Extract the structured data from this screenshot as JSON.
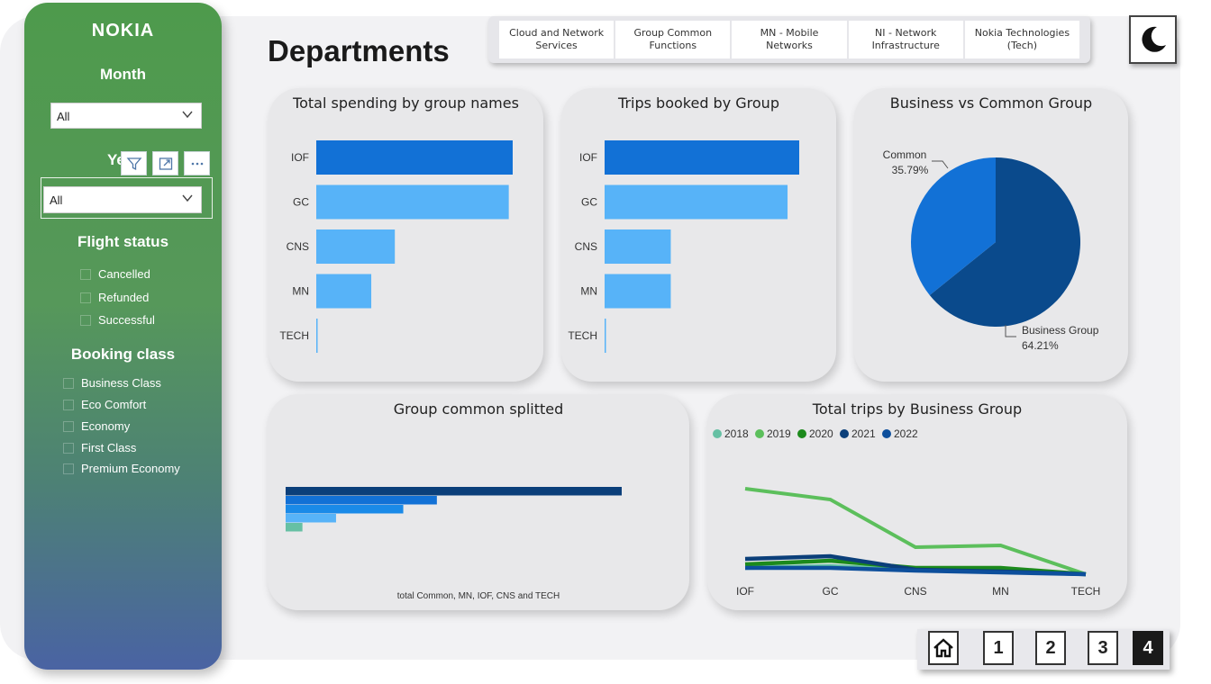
{
  "sidebar": {
    "logo": "NOKIA",
    "month_label": "Month",
    "month_value": "All",
    "year_label": "Ye",
    "year_value": "All",
    "flight_status_label": "Flight status",
    "flight_status": [
      "Cancelled",
      "Refunded",
      "Successful"
    ],
    "booking_class_label": "Booking class",
    "booking_class": [
      "Business Class",
      "Eco Comfort",
      "Economy",
      "First Class",
      "Premium Economy"
    ]
  },
  "header": {
    "title": "Departments",
    "tabs": [
      "Cloud and Network Services",
      "Group Common Functions",
      "MN - Mobile Networks",
      "NI - Network Infrastructure",
      "Nokia Technologies (Tech)"
    ]
  },
  "colors": {
    "dark_blue": "#0a4a8c",
    "mid_blue": "#1271d6",
    "light_blue": "#57b3f8",
    "teal": "#66c0a4",
    "green_light": "#5cbf5c",
    "green_dark": "#1c8a1c",
    "navy": "#0b3f7a"
  },
  "chart_data": [
    {
      "type": "bar",
      "title": "Total spending by group names",
      "categories": [
        "IOF",
        "GC",
        "CNS",
        "MN",
        "TECH"
      ],
      "values": [
        100,
        98,
        40,
        28,
        0.5
      ]
    },
    {
      "type": "bar",
      "title": "Trips booked by Group",
      "categories": [
        "IOF",
        "GC",
        "CNS",
        "MN",
        "TECH"
      ],
      "values": [
        100,
        94,
        34,
        34,
        0.5
      ]
    },
    {
      "type": "pie",
      "title": "Business vs Common Group",
      "labels": [
        "Common",
        "Business Group"
      ],
      "values": [
        35.79,
        64.21
      ],
      "value_labels": [
        "35.79%",
        "64.21%"
      ]
    },
    {
      "type": "bar",
      "title": "Group common splitted",
      "xlabel": "total Common, MN, IOF, CNS and TECH",
      "values": [
        100,
        45,
        35,
        15,
        5
      ]
    },
    {
      "type": "line",
      "title": "Total trips by Business Group",
      "categories": [
        "IOF",
        "GC",
        "CNS",
        "MN",
        "TECH"
      ],
      "series": [
        {
          "name": "2018",
          "values": [
            12,
            14,
            10,
            9,
            5
          ]
        },
        {
          "name": "2019",
          "values": [
            100,
            88,
            35,
            37,
            5
          ]
        },
        {
          "name": "2020",
          "values": [
            16,
            20,
            12,
            12,
            5
          ]
        },
        {
          "name": "2021",
          "values": [
            22,
            25,
            10,
            8,
            5
          ]
        },
        {
          "name": "2022",
          "values": [
            12,
            12,
            9,
            7,
            5
          ]
        }
      ]
    }
  ],
  "nav": {
    "pages": [
      "1",
      "2",
      "3",
      "4"
    ],
    "active": "4"
  }
}
